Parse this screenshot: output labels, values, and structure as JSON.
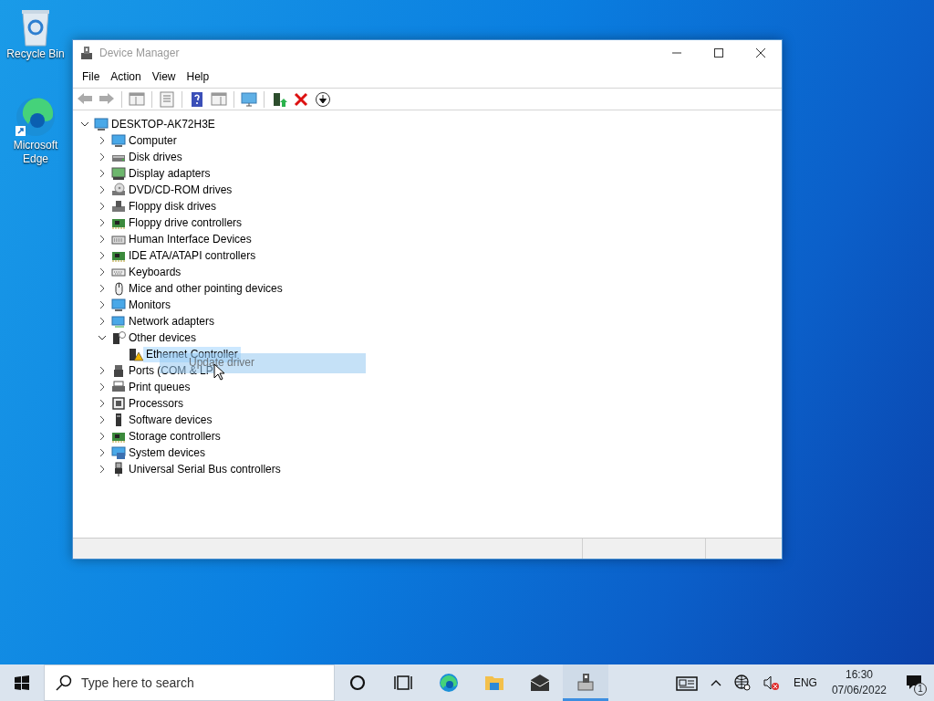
{
  "desktop_icons": [
    {
      "label": "Recycle Bin"
    },
    {
      "label": "Microsoft Edge"
    }
  ],
  "window": {
    "title": "Device Manager"
  },
  "menu": [
    {
      "label": "File"
    },
    {
      "label": "Action"
    },
    {
      "label": "View"
    },
    {
      "label": "Help"
    }
  ],
  "tree": {
    "label": "DESKTOP-AK72H3E",
    "expanded": true,
    "children": [
      {
        "label": "Computer",
        "expanded": false,
        "selected": false
      },
      {
        "label": "Disk drives",
        "expanded": false,
        "selected": false
      },
      {
        "label": "Display adapters",
        "expanded": false,
        "selected": false
      },
      {
        "label": "DVD/CD-ROM drives",
        "expanded": false,
        "selected": false
      },
      {
        "label": "Floppy disk drives",
        "expanded": false,
        "selected": false
      },
      {
        "label": "Floppy drive controllers",
        "expanded": false,
        "selected": false
      },
      {
        "label": "Human Interface Devices",
        "expanded": false,
        "selected": false
      },
      {
        "label": "IDE ATA/ATAPI controllers",
        "expanded": false,
        "selected": false
      },
      {
        "label": "Keyboards",
        "expanded": false,
        "selected": false
      },
      {
        "label": "Mice and other pointing devices",
        "expanded": false,
        "selected": false
      },
      {
        "label": "Monitors",
        "expanded": false,
        "selected": false
      },
      {
        "label": "Network adapters",
        "expanded": false,
        "selected": false
      },
      {
        "label": "Other devices",
        "expanded": true,
        "selected": false,
        "children": [
          {
            "label": "Ethernet Controller",
            "selected": true
          }
        ]
      },
      {
        "label": "Ports (COM & LP",
        "expanded": false,
        "selected": false
      },
      {
        "label": "Print queues",
        "expanded": false,
        "selected": false
      },
      {
        "label": "Processors",
        "expanded": false,
        "selected": false
      },
      {
        "label": "Software devices",
        "expanded": false,
        "selected": false
      },
      {
        "label": "Storage controllers",
        "expanded": false,
        "selected": false
      },
      {
        "label": "System devices",
        "expanded": false,
        "selected": false
      },
      {
        "label": "Universal Serial Bus controllers",
        "expanded": false,
        "selected": false
      }
    ]
  },
  "drag_ghost": {
    "text": "Update driver"
  },
  "taskbar": {
    "search": {
      "placeholder": "Type here to search"
    },
    "language": "ENG",
    "time": "16:30",
    "date": "07/06/2022",
    "notification_count": "1"
  }
}
